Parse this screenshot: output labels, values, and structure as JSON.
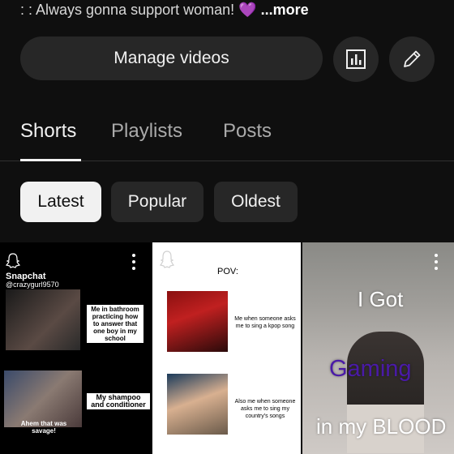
{
  "bio": {
    "prefix": ": : Always gonna support woman!",
    "emoji": "💜",
    "more": " ...more"
  },
  "actions": {
    "manage": "Manage videos"
  },
  "tabs": [
    "Shorts",
    "Playlists",
    "Posts"
  ],
  "chips": [
    "Latest",
    "Popular",
    "Oldest"
  ],
  "shorts": [
    {
      "snap_label": "Snapchat",
      "snap_user": "@crazygurl9570",
      "caption1": "Me in bathroom practicing how to answer that one boy in my school",
      "caption2": "My shampoo and conditioner",
      "caption3": "Ahem that was savage!"
    },
    {
      "pov": "POV:",
      "text1": "Me when someone asks me to sing a kpop song",
      "text2": "Also me when someone asks me to sing my country's songs"
    },
    {
      "line1": "I Got",
      "line2": "Gaming",
      "line3": "in my BLOOD"
    }
  ],
  "colors": {
    "bg": "#0f0f0f",
    "chip": "#272727",
    "heart": "#9b4fd6",
    "gaming": "#4a1aa8"
  }
}
